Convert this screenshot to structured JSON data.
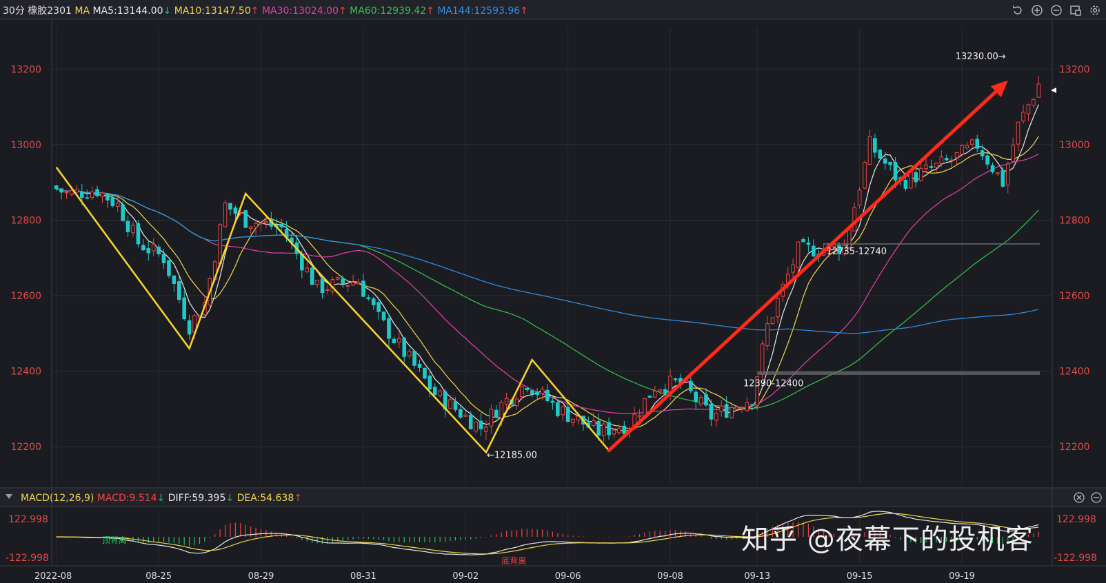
{
  "header": {
    "period": "30分",
    "symbol": "橡胶2301",
    "ma_label": "MA",
    "items": [
      {
        "text": "MA5:13144.00",
        "arrow": "↓",
        "color": "#e8e8e8",
        "arrow_color": "#22c55e"
      },
      {
        "text": "MA10:13147.50",
        "arrow": "↑",
        "color": "#f2d64b",
        "arrow_color": "#ef4444"
      },
      {
        "text": "MA30:13024.00",
        "arrow": "↑",
        "color": "#e040a8",
        "arrow_color": "#ef4444"
      },
      {
        "text": "MA60:12939.42",
        "arrow": "↑",
        "color": "#33c24d",
        "arrow_color": "#ef4444"
      },
      {
        "text": "MA144:12593.96",
        "arrow": "↑",
        "color": "#2f8fe8",
        "arrow_color": "#ef4444"
      }
    ]
  },
  "toolbar_icons": [
    "undo-icon",
    "zoom-in-icon",
    "zoom-out-icon",
    "layout-icon",
    "settings-icon"
  ],
  "macd_header": {
    "title": "MACD(12,26,9)",
    "macd": "MACD:9.514",
    "macd_arrow": "↓",
    "diff": "DIFF:59.395",
    "diff_arrow": "↓",
    "dea": "DEA:54.638",
    "dea_arrow": "↑"
  },
  "macd_axis": {
    "top": "122.998",
    "bottom": "-122.998"
  },
  "watermark": "知乎 @夜幕下的投机客",
  "colors": {
    "up": "#ef4444",
    "down": "#1fc9c9",
    "axis_text": "#e04a4a",
    "trend_yellow": "#f5d328",
    "trend_red": "#ff2a1a"
  },
  "chart_data": {
    "type": "candlestick",
    "period": "30分",
    "ylim": [
      12100,
      13310
    ],
    "y_ticks": [
      "12200",
      "12400",
      "12600",
      "12800",
      "13000",
      "13200"
    ],
    "x_ticks": [
      "2022-08",
      "08-25",
      "08-29",
      "08-31",
      "09-02",
      "09-06",
      "09-08",
      "09-13",
      "09-15",
      "09-19"
    ],
    "x_tick_positions": [
      0,
      20,
      40,
      60,
      80,
      100,
      120,
      137,
      157,
      177
    ],
    "bar_count": 193,
    "price_anchors": [
      [
        0,
        12890
      ],
      [
        3,
        12870
      ],
      [
        9,
        12880
      ],
      [
        13,
        12840
      ],
      [
        17,
        12740
      ],
      [
        22,
        12700
      ],
      [
        27,
        12520
      ],
      [
        30,
        12580
      ],
      [
        34,
        12840
      ],
      [
        38,
        12800
      ],
      [
        45,
        12780
      ],
      [
        52,
        12620
      ],
      [
        60,
        12640
      ],
      [
        64,
        12540
      ],
      [
        75,
        12340
      ],
      [
        84,
        12250
      ],
      [
        87,
        12300
      ],
      [
        93,
        12370
      ],
      [
        99,
        12300
      ],
      [
        107,
        12240
      ],
      [
        113,
        12260
      ],
      [
        118,
        12360
      ],
      [
        123,
        12370
      ],
      [
        129,
        12280
      ],
      [
        137,
        12330
      ],
      [
        140,
        12520
      ],
      [
        146,
        12720
      ],
      [
        155,
        12730
      ],
      [
        160,
        13000
      ],
      [
        166,
        12900
      ],
      [
        176,
        12960
      ],
      [
        181,
        13000
      ],
      [
        186,
        12900
      ],
      [
        189,
        13050
      ],
      [
        193,
        13160
      ]
    ],
    "annotations": [
      {
        "label": "13230.00→",
        "bar": 186,
        "price": 13230
      },
      {
        "label": "←12185.00",
        "bar": 84,
        "price": 12185
      },
      {
        "label": "12735-12740",
        "price": 12737
      },
      {
        "label": "12390-12400",
        "price": 12395
      }
    ],
    "levels": [
      12737,
      12395
    ],
    "zigzag": [
      [
        0,
        12940
      ],
      [
        26,
        12460
      ],
      [
        37,
        12870
      ],
      [
        84,
        12185
      ],
      [
        93,
        12430
      ],
      [
        108,
        12190
      ]
    ],
    "trend_arrow": {
      "from": [
        108,
        12190
      ],
      "to": [
        186,
        13170
      ]
    },
    "ma_series": [
      {
        "name": "MA5",
        "color": "#e8e8e8"
      },
      {
        "name": "MA10",
        "color": "#f2d64b"
      },
      {
        "name": "MA30",
        "color": "#e040a8"
      },
      {
        "name": "MA60",
        "color": "#33c24d"
      },
      {
        "name": "MA144",
        "color": "#2f8fe8"
      }
    ],
    "macd_labels": [
      {
        "label": "顶背离",
        "bar": 10,
        "color": "#22c55e"
      },
      {
        "label": "底背离",
        "bar": 87,
        "color": "#ef4444"
      }
    ],
    "macd_ylim": [
      -122.998,
      122.998
    ]
  }
}
